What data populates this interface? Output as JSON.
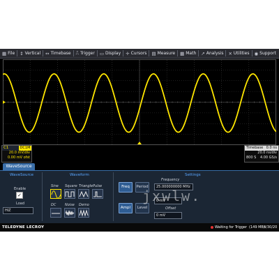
{
  "menu": [
    {
      "icon": "file-icon",
      "glyph": "▦",
      "label": "File"
    },
    {
      "icon": "vertical-icon",
      "glyph": "↕",
      "label": "Vertical"
    },
    {
      "icon": "timebase-icon",
      "glyph": "↔",
      "label": "Timebase"
    },
    {
      "icon": "trigger-icon",
      "glyph": "⎍",
      "label": "Trigger"
    },
    {
      "icon": "display-icon",
      "glyph": "▭",
      "label": "Display"
    },
    {
      "icon": "cursors-icon",
      "glyph": "✛",
      "label": "Cursors"
    },
    {
      "icon": "measure-icon",
      "glyph": "▤",
      "label": "Measure"
    },
    {
      "icon": "math-icon",
      "glyph": "▦",
      "label": "Math"
    },
    {
      "icon": "analysis-icon",
      "glyph": "↗",
      "label": "Analysis"
    },
    {
      "icon": "utilities-icon",
      "glyph": "✕",
      "label": "Utilities"
    },
    {
      "icon": "support-icon",
      "glyph": "◉",
      "label": "Support"
    }
  ],
  "waveform": {
    "color": "#ffe600",
    "cycles": 5.5
  },
  "ch1": {
    "label": "C1",
    "coupling": "DC1M",
    "scale": "20.0 mV/div",
    "offset": "0.00 mV ofst"
  },
  "timebase": {
    "label": "Timebase",
    "delay": "0.0 ns",
    "scale": "20.0 ns/div",
    "samples": "800 S",
    "rate": "4.00 GS/s"
  },
  "dialog": {
    "tab": "WaveSource",
    "wavesource": {
      "title": "WaveSource",
      "enable_label": "Enable",
      "enable_checked": "✓",
      "load_label": "Load",
      "load_value": "HiZ"
    },
    "waveform": {
      "title": "Waveform",
      "row1": [
        {
          "label": "Sine",
          "icon": "sine-wave-icon"
        },
        {
          "label": "Square",
          "icon": "square-wave-icon"
        },
        {
          "label": "Triangle",
          "icon": "triangle-wave-icon"
        },
        {
          "label": "Pulse",
          "icon": "pulse-wave-icon"
        }
      ],
      "row2": [
        {
          "label": "DC",
          "icon": "dc-wave-icon"
        },
        {
          "label": "Noise",
          "icon": "noise-wave-icon"
        },
        {
          "label": "Demo",
          "icon": "demo-wave-icon"
        }
      ]
    },
    "settings": {
      "title": "Settings",
      "freq_btn": "Freq",
      "period_btn": "Period",
      "ampl_btn": "Ampl",
      "level_btn": "Level",
      "frequency_label": "Frequency",
      "frequency_value": "25.000000000 MHz",
      "amplitude_value": "0 mV",
      "offset_label": "Offset",
      "offset_value": "0 mV"
    }
  },
  "status": {
    "brand": "TELEDYNE LECROY",
    "message": "Waiting for Trigger",
    "memory": "(149 MB)",
    "clock": "4/30/20"
  },
  "watermark": "jxwlw."
}
